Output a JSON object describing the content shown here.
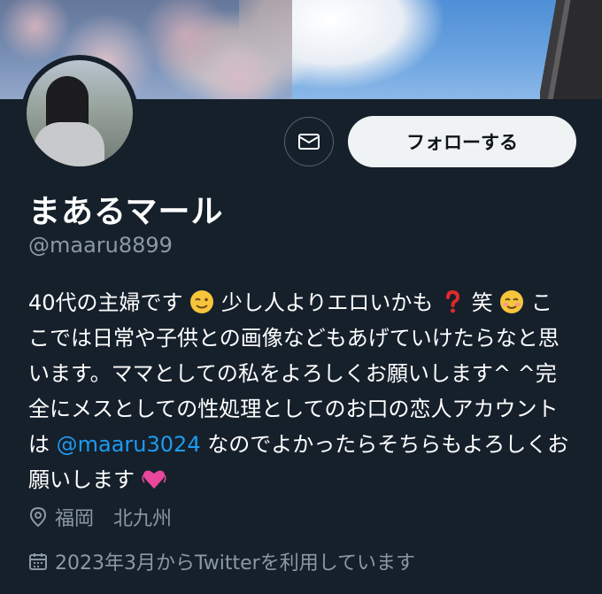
{
  "profile": {
    "display_name": "まあるマール",
    "handle": "@maaru8899",
    "follow_label": "フォローする",
    "bio": {
      "part1": "40代の主婦です",
      "part2": "少し人よりエロいかも",
      "part3": "笑",
      "part4": "ここでは日常や子供との画像などもあげていけたらなと思います。ママとしての私をよろしくお願いします^ ^完全にメスとしての性処理としてのお口の恋人アカウントは",
      "mention": "@maaru3024",
      "part5": "なのでよかったらそちらもよろしくお願いします"
    },
    "location": "福岡　北九州",
    "joined": "2023年3月からTwitterを利用しています"
  },
  "icons": {
    "message": "envelope-icon",
    "location": "map-pin-icon",
    "calendar": "calendar-icon",
    "emoji_wink": "winking-face-emoji",
    "emoji_question": "red-question-mark-emoji",
    "emoji_smile": "smiling-face-emoji",
    "emoji_heart": "beating-heart-emoji"
  },
  "colors": {
    "background": "#15202b",
    "text_secondary": "#8b98a5",
    "link": "#1d9bf0",
    "follow_button_bg": "#eff3f4"
  }
}
